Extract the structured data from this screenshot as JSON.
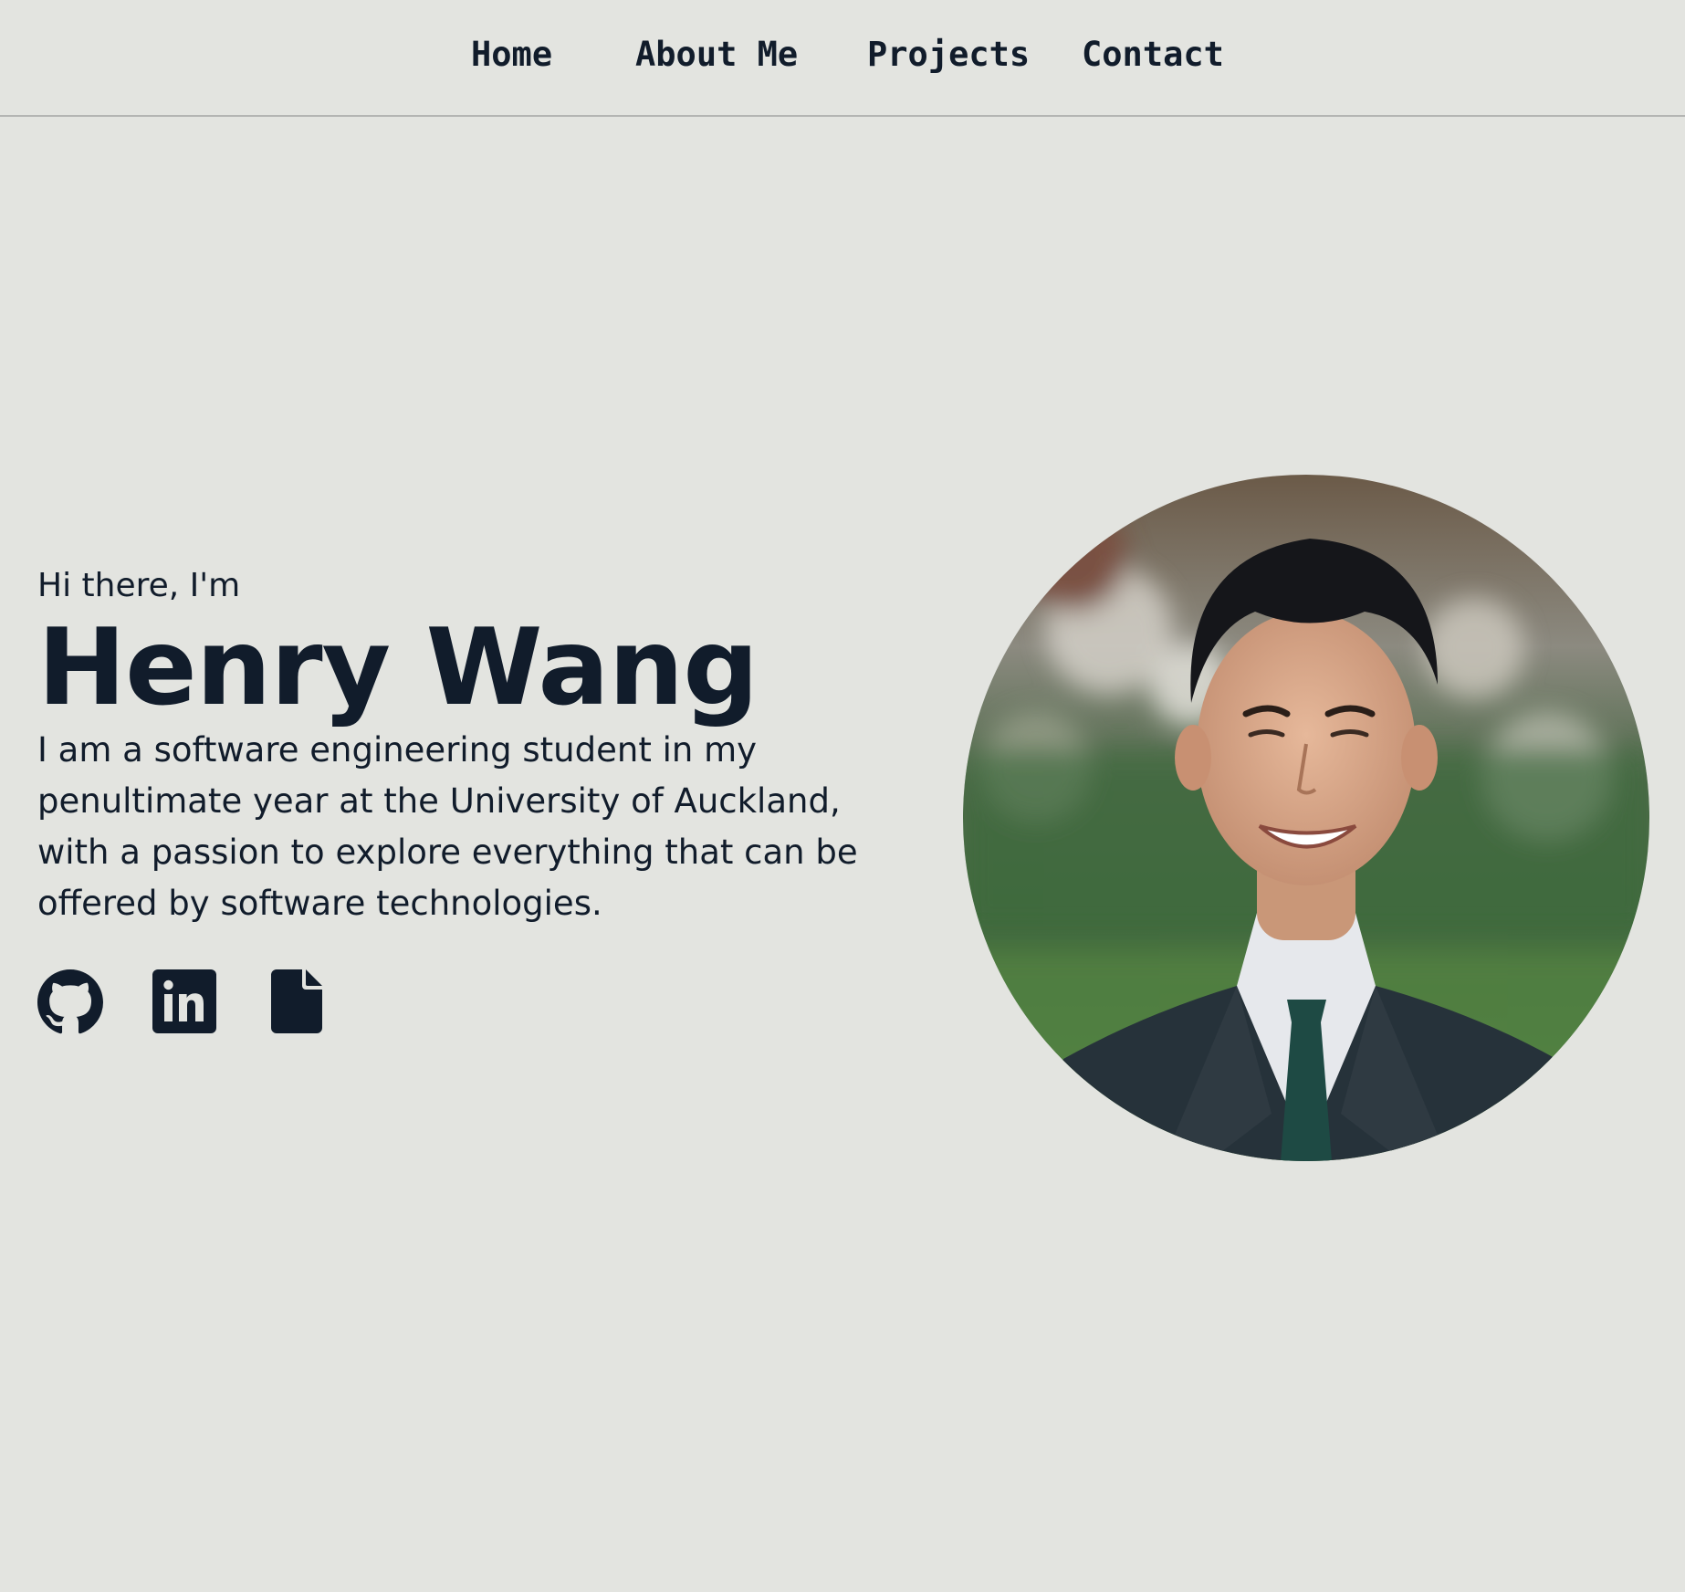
{
  "nav": {
    "items": [
      {
        "label": "Home"
      },
      {
        "label": "About Me"
      },
      {
        "label": "Projects"
      },
      {
        "label": "Contact"
      }
    ]
  },
  "hero": {
    "greeting": "Hi there, I'm",
    "name": "Henry Wang",
    "bio": "I am a software engineering student in my penultimate year at the University of Auckland, with a passion to explore everything that can be offered by software technologies."
  },
  "social": {
    "icons": [
      "github-icon",
      "linkedin-icon",
      "file-icon"
    ]
  },
  "photo": {
    "subject": "portrait-photo"
  },
  "colors": {
    "background": "#e3e4e0",
    "text": "#111c2b",
    "divider": "#b4b5b3"
  }
}
